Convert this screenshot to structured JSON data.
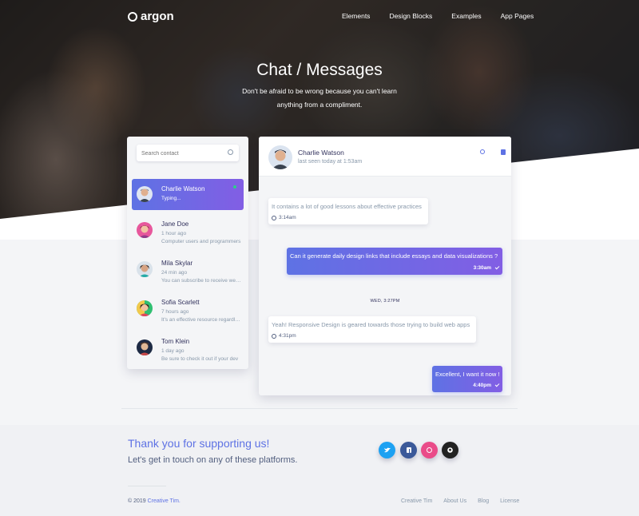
{
  "navbar": {
    "brand": "argon",
    "links": [
      "Elements",
      "Design Blocks",
      "Examples",
      "App Pages"
    ]
  },
  "hero": {
    "title": "Chat / Messages",
    "subtitle": "Don't be afraid to be wrong because you can't learn anything from a compliment."
  },
  "contacts": {
    "search_placeholder": "Search contact",
    "items": [
      {
        "name": "Charlie Watson",
        "status": "Typing...",
        "active": true
      },
      {
        "name": "Jane Doe",
        "time": "1 hour ago",
        "message": "Computer users and programmers"
      },
      {
        "name": "Mila Skylar",
        "time": "24 min ago",
        "message": "You can subscribe to receive weekly"
      },
      {
        "name": "Sofia Scarlett",
        "time": "7 hours ago",
        "message": "It's an effective resource regardless"
      },
      {
        "name": "Tom Klein",
        "time": "1 day ago",
        "message": "Be sure to check it out if your dev"
      }
    ]
  },
  "chat": {
    "header": {
      "name": "Charlie Watson",
      "seen": "last seen today at 1:53am"
    },
    "messages": [
      {
        "direction": "in",
        "text": "It contains a lot of good lessons about effective practices",
        "time": "3:14am"
      },
      {
        "direction": "out",
        "text": "Can it generate daily design links that include essays and data visualizations ?",
        "time": "3:30am"
      },
      {
        "direction": "in",
        "text": "Yeah! Responsive Design is geared towards those trying to build web apps",
        "time": "4:31pm"
      },
      {
        "direction": "out",
        "text": "Excellent, I want it now !",
        "time": "4:40pm"
      }
    ],
    "date_separator": "WED, 3:27PM"
  },
  "footer": {
    "thanks": "Thank you for supporting us!",
    "touch": "Let's get in touch on any of these platforms.",
    "social": [
      {
        "icon": "twitter-icon",
        "color": "#1da1f2"
      },
      {
        "icon": "facebook-icon",
        "color": "#3b5999"
      },
      {
        "icon": "dribbble-icon",
        "color": "#ea4c89"
      },
      {
        "icon": "github-icon",
        "color": "#222222"
      }
    ],
    "copyright_prefix": "© 2019",
    "copyright_link": "Creative Tim.",
    "links": [
      "Creative Tim",
      "About Us",
      "Blog",
      "License"
    ]
  },
  "colors": {
    "primary": "#5e72e4",
    "gradient_end": "#825ee4",
    "success": "#2dce89"
  }
}
